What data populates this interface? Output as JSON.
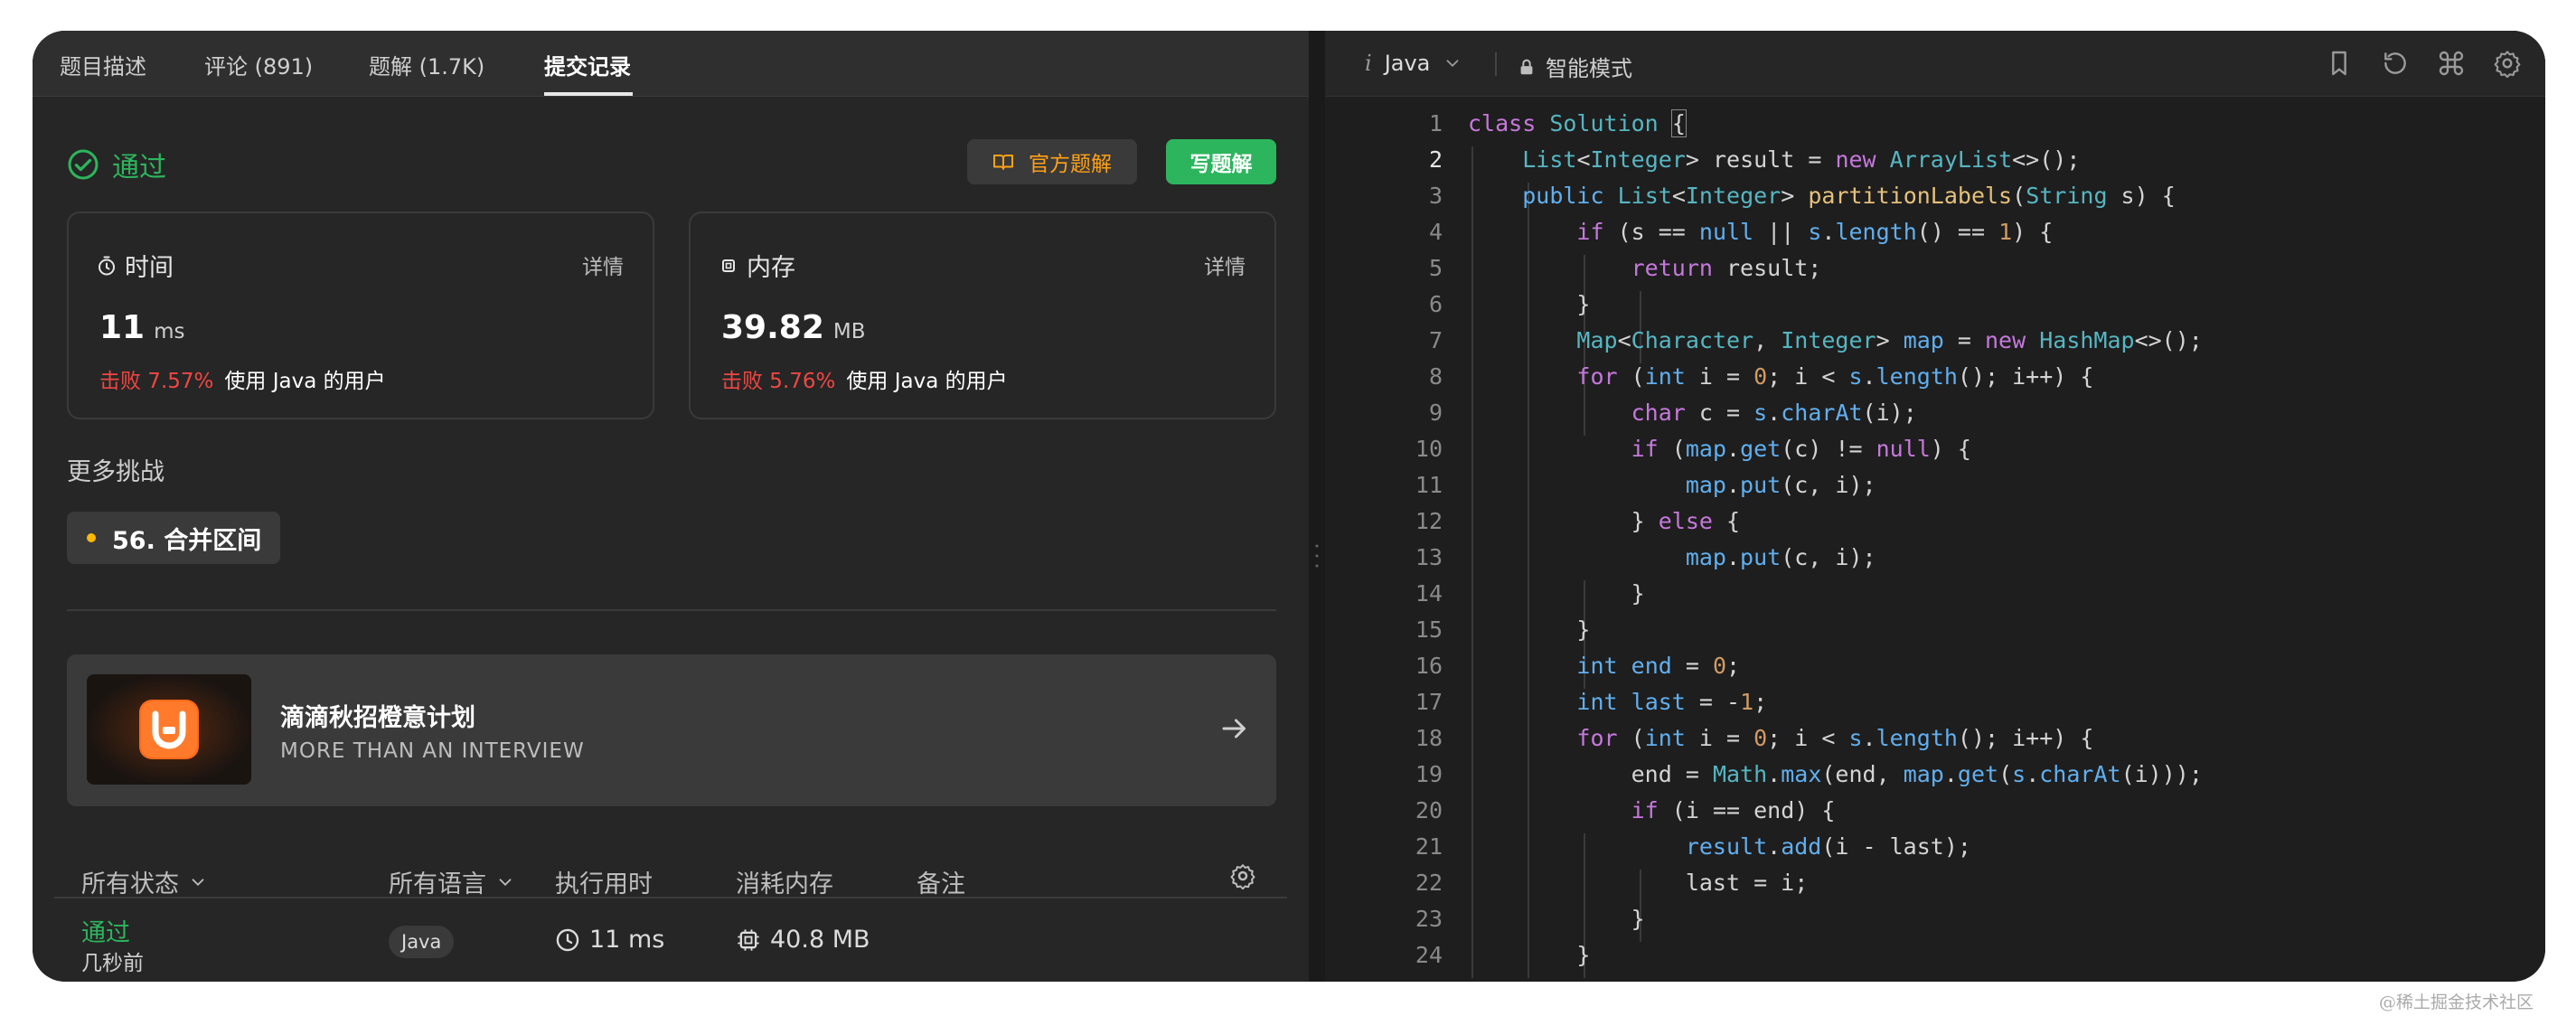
{
  "tabs": [
    {
      "label": "题目描述"
    },
    {
      "label": "评论 (891)"
    },
    {
      "label": "题解 (1.7K)"
    },
    {
      "label": "提交记录"
    }
  ],
  "result": {
    "status": "通过",
    "official_solution_label": "官方题解",
    "write_solution_label": "写题解"
  },
  "time_card": {
    "title": "时间",
    "detail": "详情",
    "value": "11",
    "unit": "ms",
    "beat_pct": "击败 7.57%",
    "beat_text": "使用 Java 的用户"
  },
  "memory_card": {
    "title": "内存",
    "detail": "详情",
    "value": "39.82",
    "unit": "MB",
    "beat_pct": "击败 5.76%",
    "beat_text": "使用 Java 的用户"
  },
  "more_challenges": {
    "title": "更多挑战",
    "items": [
      {
        "label": "56. 合并区间"
      }
    ]
  },
  "promo": {
    "title": "滴滴秋招橙意计划",
    "subtitle": "MORE THAN AN INTERVIEW"
  },
  "table": {
    "headers": {
      "status": "所有状态",
      "language": "所有语言",
      "runtime": "执行用时",
      "memory": "消耗内存",
      "notes": "备注"
    },
    "rows": [
      {
        "status": "通过",
        "time_ago": "几秒前",
        "language": "Java",
        "runtime": "11 ms",
        "memory": "40.8 MB"
      }
    ]
  },
  "editor": {
    "language": "Java",
    "mode": "智能模式",
    "current_line": 2,
    "line_numbers": [
      "1",
      "2",
      "3",
      "4",
      "5",
      "6",
      "7",
      "8",
      "9",
      "10",
      "11",
      "12",
      "13",
      "14",
      "15",
      "16",
      "17",
      "18",
      "19",
      "20",
      "21",
      "22",
      "23",
      "24"
    ]
  },
  "watermark": "@稀土掘金技术社区",
  "colors": {
    "pass_green": "#2db55d",
    "beat_red": "#ef4743",
    "brand_orange": "#ffa116"
  }
}
